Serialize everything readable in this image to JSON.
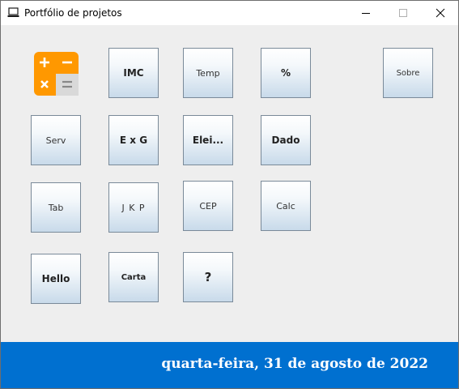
{
  "window": {
    "title": "Portfólio de projetos",
    "controls": {
      "minimize": "—",
      "maximize": "☐",
      "close": "✕"
    }
  },
  "logo": {
    "icon": "calculator-icon",
    "colors": {
      "orange": "#ff9800",
      "gray": "#d9d9d9"
    },
    "symbols": {
      "plus": "+",
      "minus": "−",
      "times": "×",
      "equals": "="
    }
  },
  "buttons": {
    "imc": "IMC",
    "temp": "Temp",
    "percent": "%",
    "sobre": "Sobre",
    "serv": "Serv",
    "exg": "E x G",
    "elei": "Elei...",
    "dado": "Dado",
    "tab": "Tab",
    "jkp": "J K P",
    "cep": "CEP",
    "calc": "Calc",
    "hello": "Hello",
    "carta": "Carta",
    "question": "?"
  },
  "footer": {
    "date": "quarta-feira, 31 de agosto de 2022",
    "background": "#0070d0"
  }
}
